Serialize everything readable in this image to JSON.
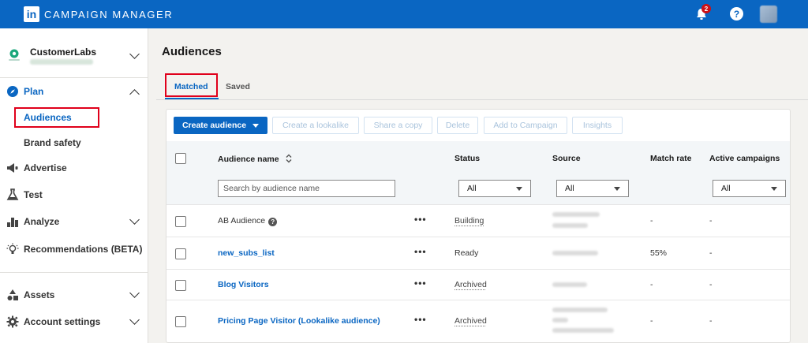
{
  "app": {
    "title": "CAMPAIGN MANAGER",
    "logo_text": "in"
  },
  "header": {
    "notification_count": "2",
    "help_glyph": "?"
  },
  "account": {
    "name": "CustomerLabs"
  },
  "sidebar": {
    "sections": [
      {
        "label": "Plan",
        "icon": "compass-icon",
        "expanded": true
      },
      {
        "label": "Advertise",
        "icon": "megaphone-icon"
      },
      {
        "label": "Test",
        "icon": "flask-icon"
      },
      {
        "label": "Analyze",
        "icon": "bar-chart-icon"
      },
      {
        "label": "Recommendations (BETA)",
        "icon": "lightbulb-icon"
      },
      {
        "label": "Assets",
        "icon": "shapes-icon"
      },
      {
        "label": "Account settings",
        "icon": "gear-icon"
      }
    ],
    "plan_items": [
      {
        "label": "Audiences",
        "active": true
      },
      {
        "label": "Brand safety"
      }
    ]
  },
  "main": {
    "title": "Audiences",
    "tabs": [
      {
        "label": "Matched",
        "active": true
      },
      {
        "label": "Saved"
      }
    ],
    "toolbar": {
      "create": "Create audience",
      "lookalike": "Create a lookalike",
      "share": "Share a copy",
      "delete": "Delete",
      "add_campaign": "Add to Campaign",
      "insights": "Insights"
    },
    "table": {
      "columns": {
        "name": "Audience name",
        "status": "Status",
        "source": "Source",
        "match_rate": "Match rate",
        "active_campaigns": "Active campaigns"
      },
      "filters": {
        "search_placeholder": "Search by audience name",
        "status": "All",
        "source": "All",
        "active_campaigns": "All"
      },
      "rows": [
        {
          "name": "AB Audience",
          "status": "Building",
          "match_rate": "-",
          "active_campaigns": "-"
        },
        {
          "name": "new_subs_list",
          "status": "Ready",
          "match_rate": "55%",
          "active_campaigns": "-"
        },
        {
          "name": "Blog Visitors",
          "status": "Archived",
          "match_rate": "-",
          "active_campaigns": "-"
        },
        {
          "name": "Pricing Page Visitor (Lookalike audience)",
          "status": "Archived",
          "match_rate": "-",
          "active_campaigns": "-"
        }
      ],
      "more_glyph": "•••"
    }
  },
  "colors": {
    "brand": "#0a66c2",
    "highlight": "#e0001b",
    "badge": "#cc1016"
  }
}
